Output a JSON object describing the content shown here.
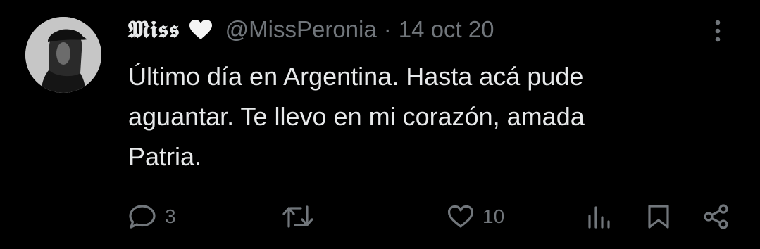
{
  "tweet": {
    "display_name": "𝕸𝖎𝖘𝖘",
    "name_emoji_icon": "white-heart-icon",
    "handle": "@MissPeronia",
    "separator": "·",
    "date": "14 oct 20",
    "text_lines": [
      "Último día en Argentina. Hasta acá pude",
      "aguantar. Te llevo en mi corazón, amada",
      "Patria."
    ],
    "actions": {
      "replies": "3",
      "retweets": "",
      "likes": "10"
    },
    "icons": {
      "more": "more-vertical-icon",
      "reply": "reply-bubble-icon",
      "retweet": "retweet-icon",
      "like": "heart-outline-icon",
      "views": "analytics-bars-icon",
      "bookmark": "bookmark-icon",
      "share": "share-icon"
    },
    "colors": {
      "background": "#000000",
      "primary_text": "#e7e9ea",
      "secondary_text": "#71767b"
    }
  }
}
